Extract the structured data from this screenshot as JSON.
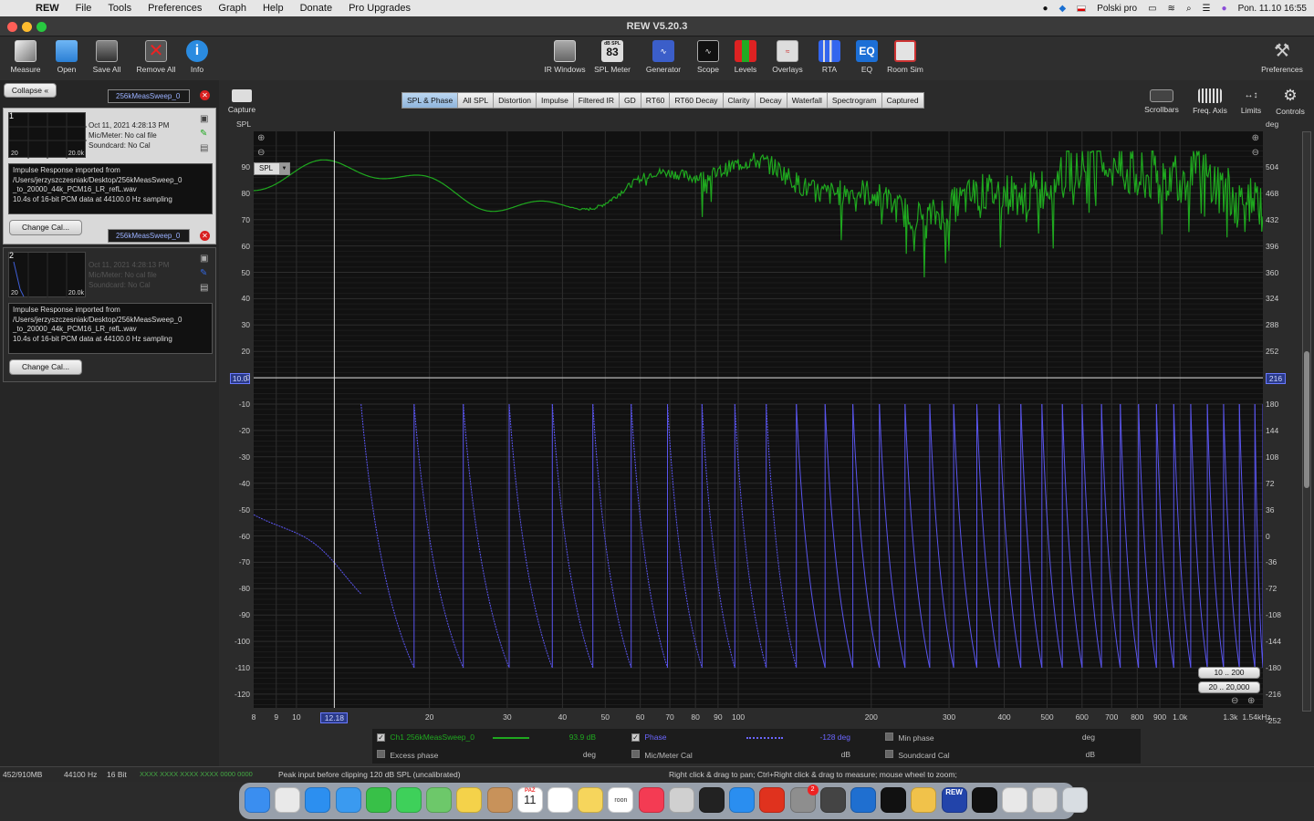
{
  "menubar": {
    "app": "REW",
    "items": [
      "File",
      "Tools",
      "Preferences",
      "Graph",
      "Help",
      "Donate",
      "Pro Upgrades"
    ],
    "keyboard": "Polski pro",
    "clock": "Pon. 11.10  16:55"
  },
  "window": {
    "title": "REW V5.20.3"
  },
  "toolbar": {
    "left": [
      "Measure",
      "Open",
      "Save All",
      "Remove All",
      "Info"
    ],
    "center": [
      "IR Windows",
      "SPL Meter",
      "Generator",
      "Scope",
      "Levels",
      "Overlays",
      "RTA",
      "EQ",
      "Room Sim"
    ],
    "spl_meter_value": "83",
    "spl_meter_unit": "dB SPL",
    "right": "Preferences",
    "capture": "Capture"
  },
  "graph_controls": [
    "Scrollbars",
    "Freq. Axis",
    "Limits",
    "Controls"
  ],
  "graph_tabs": [
    "SPL & Phase",
    "All SPL",
    "Distortion",
    "Impulse",
    "Filtered IR",
    "GD",
    "RT60",
    "RT60 Decay",
    "Clarity",
    "Decay",
    "Waterfall",
    "Spectrogram",
    "Captured"
  ],
  "active_tab": "SPL & Phase",
  "left_panel": {
    "collapse_label": "Collapse",
    "measurements": [
      {
        "index": "1",
        "name": "256kMeasSweep_0",
        "date": "Oct 11, 2021 4:28:13 PM",
        "mic": "Mic/Meter: No cal file",
        "soundcard": "Soundcard: No Cal",
        "thumb_min": "20",
        "thumb_max": "20.0k",
        "desc": [
          "Impulse Response imported from",
          "/Users/jerzyszczesniak/Desktop/256kMeasSweep_0",
          "_to_20000_44k_PCM16_LR_refL.wav",
          "10.4s of 16-bit PCM data at 44100.0 Hz sampling"
        ],
        "change_cal": "Change Cal..."
      },
      {
        "index": "2",
        "name": "256kMeasSweep_0",
        "date": "Oct 11, 2021 4:28:13 PM",
        "mic": "Mic/Meter: No cal file",
        "soundcard": "Soundcard: No Cal",
        "thumb_min": "20",
        "thumb_max": "20.0k",
        "desc": [
          "Impulse Response imported from",
          "/Users/jerzyszczesniak/Desktop/256kMeasSweep_0",
          "_to_20000_44k_PCM16_LR_refL.wav",
          "10.4s of 16-bit PCM data at 44100.0 Hz sampling"
        ],
        "change_cal": "Change Cal..."
      }
    ]
  },
  "plot": {
    "left_axis_title": "SPL",
    "right_axis_title": "deg",
    "spl_dropdown": "SPL",
    "left_ticks": [
      "90",
      "80",
      "70",
      "60",
      "50",
      "40",
      "30",
      "20",
      "10.0",
      "0",
      "-10",
      "-20",
      "-30",
      "-40",
      "-50",
      "-60",
      "-70",
      "-80",
      "-90",
      "-100",
      "-110",
      "-120"
    ],
    "right_ticks": [
      "504",
      "468",
      "432",
      "396",
      "360",
      "324",
      "288",
      "252",
      "216",
      "180",
      "144",
      "108",
      "72",
      "36",
      "0",
      "-36",
      "-72",
      "-108",
      "-144",
      "-180",
      "-216",
      "-252"
    ],
    "x_ticks": [
      "8",
      "9",
      "10",
      "12.18",
      "20",
      "30",
      "40",
      "50",
      "60",
      "70",
      "80",
      "90",
      "100",
      "200",
      "300",
      "400",
      "500",
      "600",
      "700",
      "800",
      "900",
      "1.0k",
      "1.3k",
      "1.54kHz"
    ],
    "range_buttons": [
      "10 .. 200",
      "20 .. 20,000"
    ],
    "cursor_freq": "12.18",
    "cursor_level": "10.0",
    "cursor_deg": "216",
    "colors": {
      "spl": "#1fa81f",
      "phase": "#5a55ee"
    }
  },
  "legend": {
    "row1": [
      {
        "label": "Ch1 256kMeasSweep_0",
        "value": "93.9 dB",
        "checked": true
      },
      {
        "label": "Phase",
        "value": "-128 deg",
        "checked": true
      },
      {
        "label": "Min phase",
        "value": "deg",
        "checked": false
      }
    ],
    "row2": [
      {
        "label": "Excess phase",
        "value": "deg",
        "checked": false
      },
      {
        "label": "Mic/Meter Cal",
        "value": "dB",
        "checked": false
      },
      {
        "label": "Soundcard Cal",
        "value": "dB",
        "checked": false
      }
    ]
  },
  "status": {
    "memory": "452/910MB",
    "rate": "44100 Hz",
    "bits": "16 Bit",
    "levels": "XXXX XXXX   XXXX XXXX   0000 0000",
    "peak": "Peak input before clipping 120 dB SPL (uncalibrated)",
    "hint": "Right click & drag to pan; Ctrl+Right click & drag to measure; mouse wheel to zoom;"
  },
  "dock": {
    "calendar_month": "PAŹ",
    "calendar_day": "11",
    "badge": "2",
    "roon": "roon",
    "rew_label": "REW"
  }
}
